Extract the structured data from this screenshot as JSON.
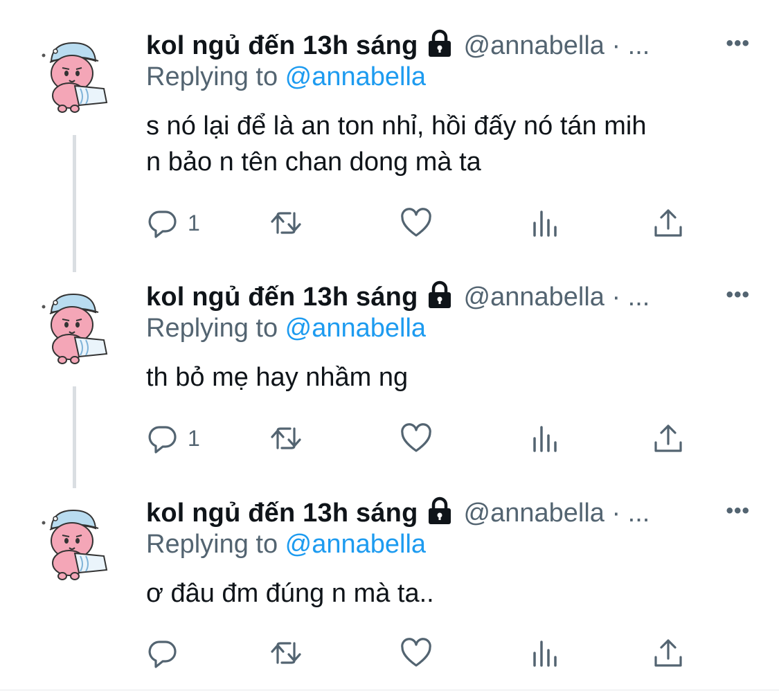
{
  "tweets": [
    {
      "author_name": "kol ngủ đến 13h sáng",
      "handle": "@annabella · ...",
      "more": "•••",
      "replying_prefix": "Replying to ",
      "replying_mention": "@annabella",
      "text_lines": [
        "s nó lại để là an ton nhỉ, hồi đấy nó tán mih",
        "n bảo n tên chan dong mà ta"
      ],
      "reply_count": "1"
    },
    {
      "author_name": "kol ngủ đến 13h sáng",
      "handle": "@annabella · ...",
      "more": "•••",
      "replying_prefix": "Replying to ",
      "replying_mention": "@annabella",
      "text_lines": [
        "th bỏ mẹ hay nhầm ng"
      ],
      "reply_count": "1"
    },
    {
      "author_name": "kol ngủ đến 13h sáng",
      "handle": "@annabella · ...",
      "more": "•••",
      "replying_prefix": "Replying to ",
      "replying_mention": "@annabella",
      "text_lines": [
        "ơ đâu đm đúng n mà ta.."
      ],
      "reply_count": ""
    }
  ],
  "icons": {
    "reply": "reply-icon",
    "retweet": "retweet-icon",
    "like": "heart-icon",
    "views": "views-icon",
    "share": "share-icon",
    "lock": "lock-icon",
    "more": "more-icon"
  },
  "colors": {
    "text": "#0f1419",
    "secondary": "#536471",
    "mention": "#1d9bf0",
    "thread": "#dadee2",
    "avatar_pink": "#f4a6b7",
    "avatar_blue": "#b9dcf0"
  }
}
